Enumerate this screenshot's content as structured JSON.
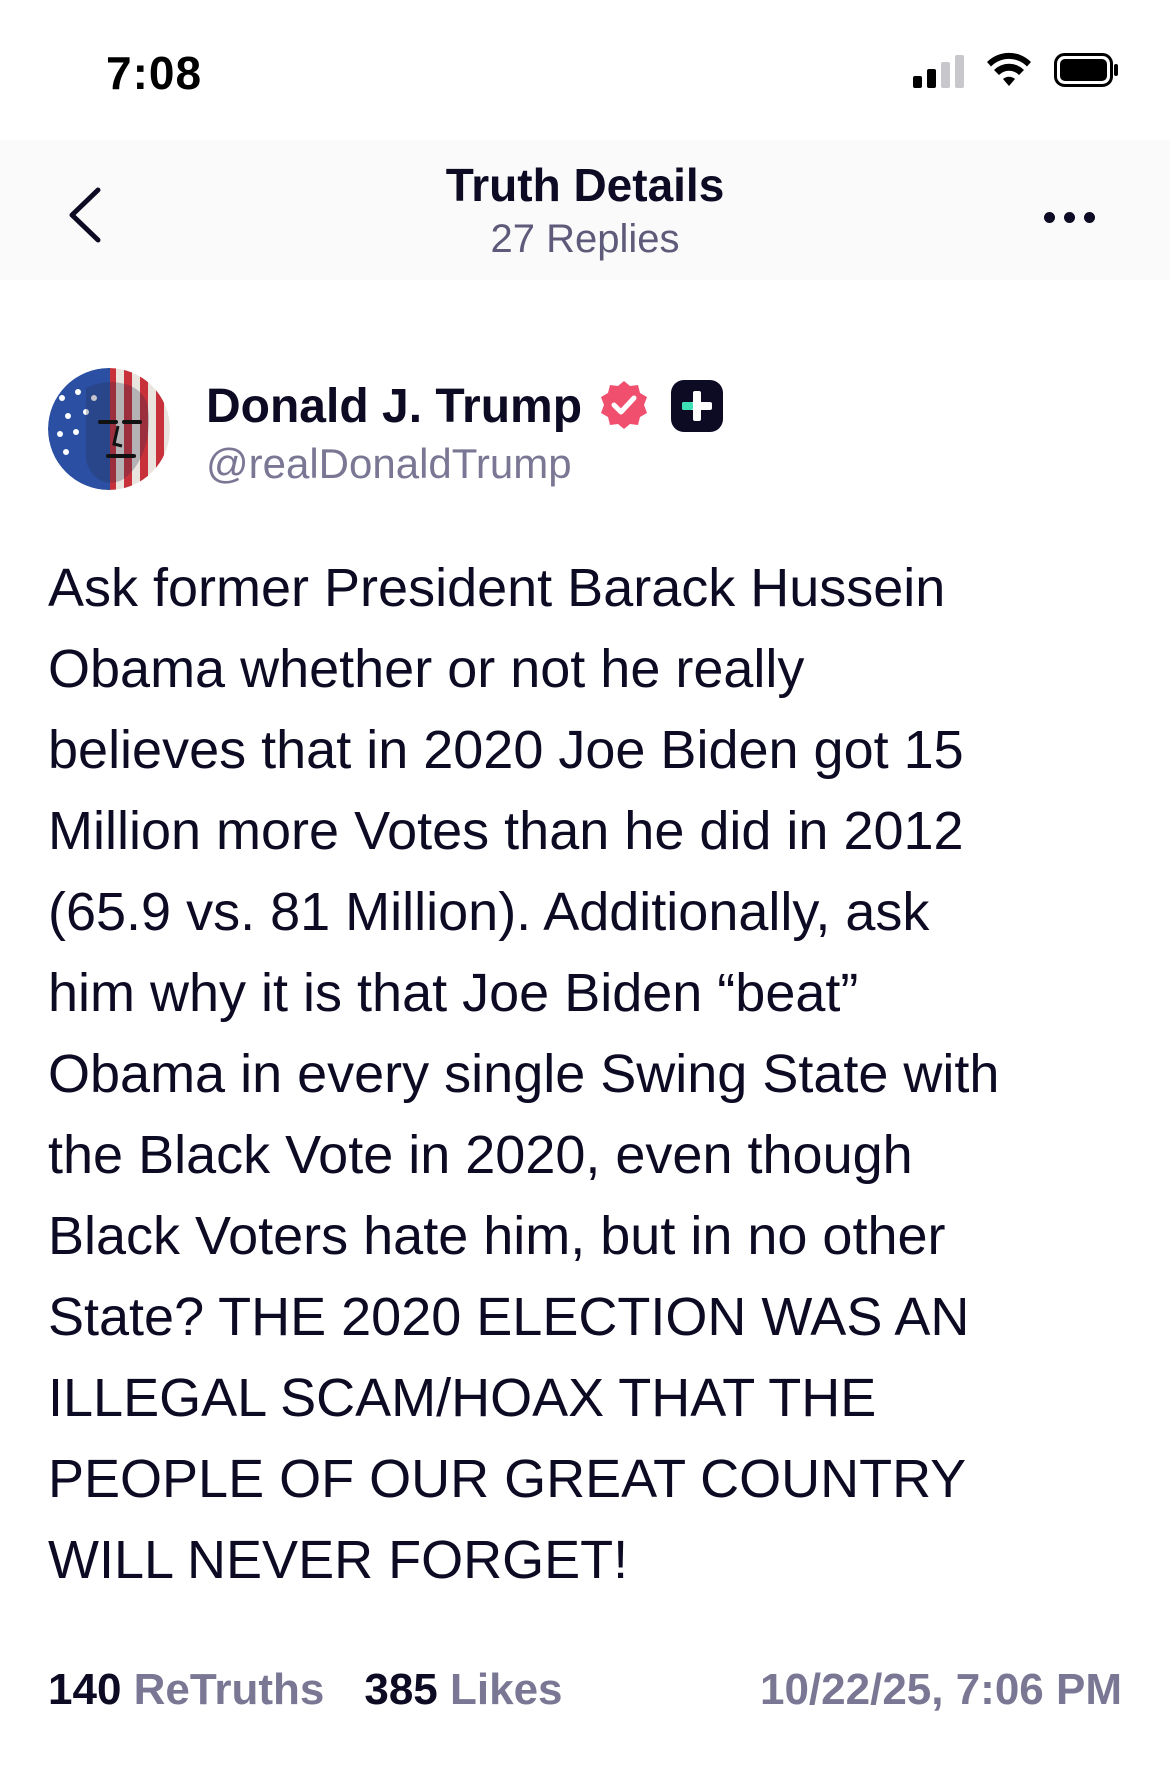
{
  "status_bar": {
    "time": "7:08"
  },
  "header": {
    "title": "Truth Details",
    "subtitle": "27 Replies"
  },
  "author": {
    "name": "Donald J. Trump",
    "handle": "@realDonaldTrump",
    "verified_color": "#f0506e",
    "plus_badge_color": "#0d0b24",
    "plus_accent": "#3ce0b4"
  },
  "post": {
    "text": "Ask former President Barack Hussein\nObama whether or not he really\nbelieves that in 2020 Joe Biden got 15\nMillion more Votes than he did in 2012\n(65.9 vs. 81 Million). Additionally, ask\nhim why it is that Joe Biden “beat”\nObama in every single Swing State with\nthe Black Vote in 2020, even though\nBlack Voters hate him, but in no other\nState? THE 2020 ELECTION WAS AN\nILLEGAL SCAM/HOAX THAT THE\nPEOPLE OF OUR GREAT COUNTRY\nWILL NEVER FORGET!"
  },
  "stats": {
    "retruths_count": "140",
    "retruths_label": "ReTruths",
    "likes_count": "385",
    "likes_label": "Likes",
    "timestamp": "10/22/25, 7:06 PM"
  },
  "icons": {
    "back": "chevron-left-icon",
    "more": "ellipsis-icon",
    "verified": "verified-badge-icon",
    "plus": "plus-badge-icon"
  }
}
